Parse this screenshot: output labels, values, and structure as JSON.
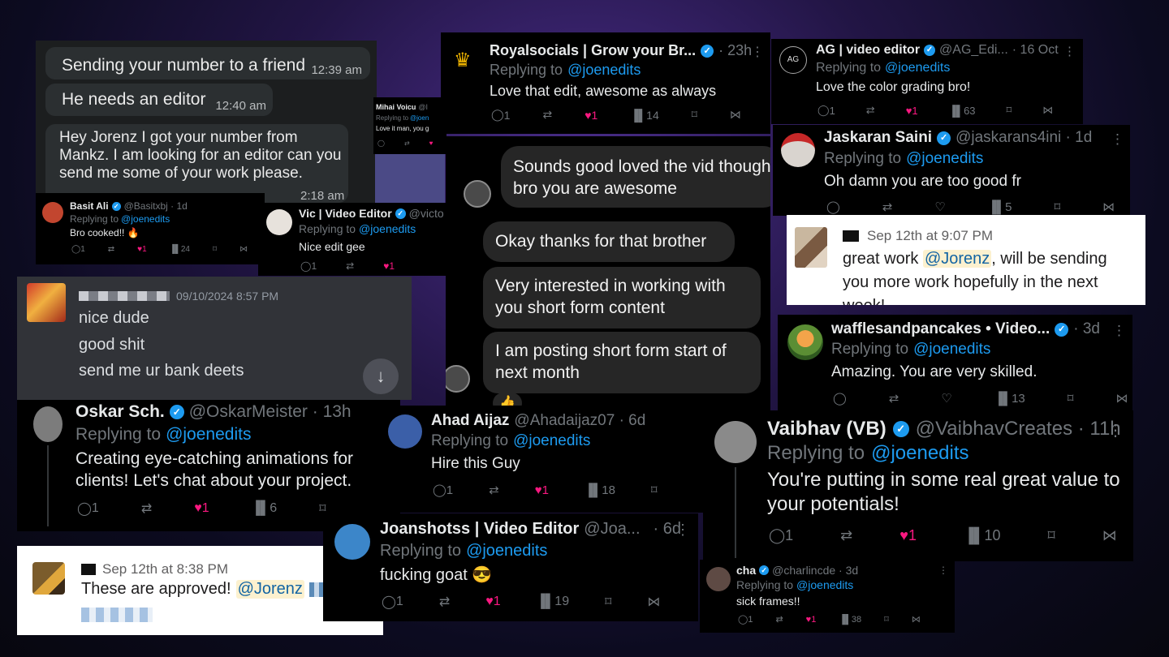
{
  "whatsapp": {
    "msg1": {
      "text": "Sending your number to a friend",
      "time": "12:39 am"
    },
    "msg2": {
      "text": "He needs an editor",
      "time": "12:40 am"
    },
    "msg3": {
      "text": "Hey Jorenz I got your number from Mankz. I am looking for an editor can you send me some of your work please.",
      "time": "2:18 am"
    }
  },
  "basit": {
    "name": "Basit Ali",
    "handle": "@Basitxbj · 1d",
    "replying": "Replying to",
    "to": "@joenedits",
    "text": "Bro cooked!! 🔥",
    "replies": "1",
    "likes": "1",
    "views": "24"
  },
  "mihai": {
    "name": "Mihai Voicu",
    "handle": "@I",
    "replying": "Replying to",
    "to": "@joen",
    "text": "Love it man, you g"
  },
  "vic": {
    "name": "Vic | Video Editor",
    "handle": "@victo",
    "replying": "Replying to",
    "to": "@joenedits",
    "text": "Nice edit gee",
    "replies": "1",
    "likes": "1"
  },
  "discord": {
    "date": "09/10/2024 8:57 PM",
    "lines": [
      "nice dude",
      "good shit",
      "send me ur bank deets"
    ]
  },
  "oskar": {
    "name": "Oskar Sch.",
    "handle": "@OskarMeister · 13h",
    "replying": "Replying to",
    "to": "@joenedits",
    "text": "Creating eye-catching animations for clients! Let's chat about your project.",
    "replies": "1",
    "likes": "1",
    "views": "6"
  },
  "slack1": {
    "date": "Sep 12th at 8:38 PM",
    "text": "These are approved!",
    "mention": "@Jorenz"
  },
  "royal": {
    "name": "Royalsocials | Grow your Br...",
    "meta": "· 23h",
    "replying": "Replying to",
    "to": "@joenedits",
    "text": "Love that edit, awesome as always",
    "replies": "1",
    "likes": "1",
    "views": "14"
  },
  "instagram": {
    "b1": "Sounds good loved the vid though bro you are awesome",
    "b2": "Okay thanks for that brother",
    "b3": "Very interested in working with you short form content",
    "b4": "I am posting short form start of next month",
    "reaction": "👍"
  },
  "ahad": {
    "name": "Ahad Aijaz",
    "handle": "@Ahadaijaz07 · 6d",
    "replying": "Replying to",
    "to": "@joenedits",
    "text": "Hire this Guy",
    "replies": "1",
    "likes": "1",
    "views": "18"
  },
  "joan": {
    "name": "Joanshotss | Video Editor",
    "handle": "@Joa...",
    "meta": "· 6d",
    "replying": "Replying to",
    "to": "@joenedits",
    "text": "fucking goat 😎",
    "replies": "1",
    "likes": "1",
    "views": "19"
  },
  "ag": {
    "avatar": "AG",
    "name": "AG | video editor",
    "handle": "@AG_Edi...",
    "meta": "· 16 Oct",
    "replying": "Replying to",
    "to": "@joenedits",
    "text": "Love the color grading bro!",
    "replies": "1",
    "likes": "1",
    "views": "63"
  },
  "jaskaran": {
    "name": "Jaskaran Saini",
    "handle": "@jaskarans4ini · 1d",
    "replying": "Replying to",
    "to": "@joenedits",
    "text": "Oh damn you are too good fr",
    "views": "5"
  },
  "slack2": {
    "date": "Sep 12th at 9:07 PM",
    "pre": "great work",
    "mention": "@Jorenz",
    "post": ", will be sending you more work hopefully in the next week!"
  },
  "waffles": {
    "name": "wafflesandpancakes • Video...",
    "meta": "· 3d",
    "replying": "Replying to",
    "to": "@joenedits",
    "text": "Amazing. You are very skilled.",
    "views": "13"
  },
  "vaibhav": {
    "name": "Vaibhav (VB)",
    "handle": "@VaibhavCreates · 11h",
    "replying": "Replying to",
    "to": "@joenedits",
    "text": "You're putting in some real great value to your potentials!",
    "replies": "1",
    "likes": "1",
    "views": "10"
  },
  "cha": {
    "name": "cha",
    "handle": "@charlincde · 3d",
    "replying": "Replying to",
    "to": "@joenedits",
    "text": "sick frames!!",
    "replies": "1",
    "likes": "1",
    "views": "38"
  },
  "colors": {
    "accent": "#1d9bf0",
    "like": "#f91880",
    "tweet_bg": "#000000",
    "slack_mention_bg": "#fcf1cf"
  }
}
